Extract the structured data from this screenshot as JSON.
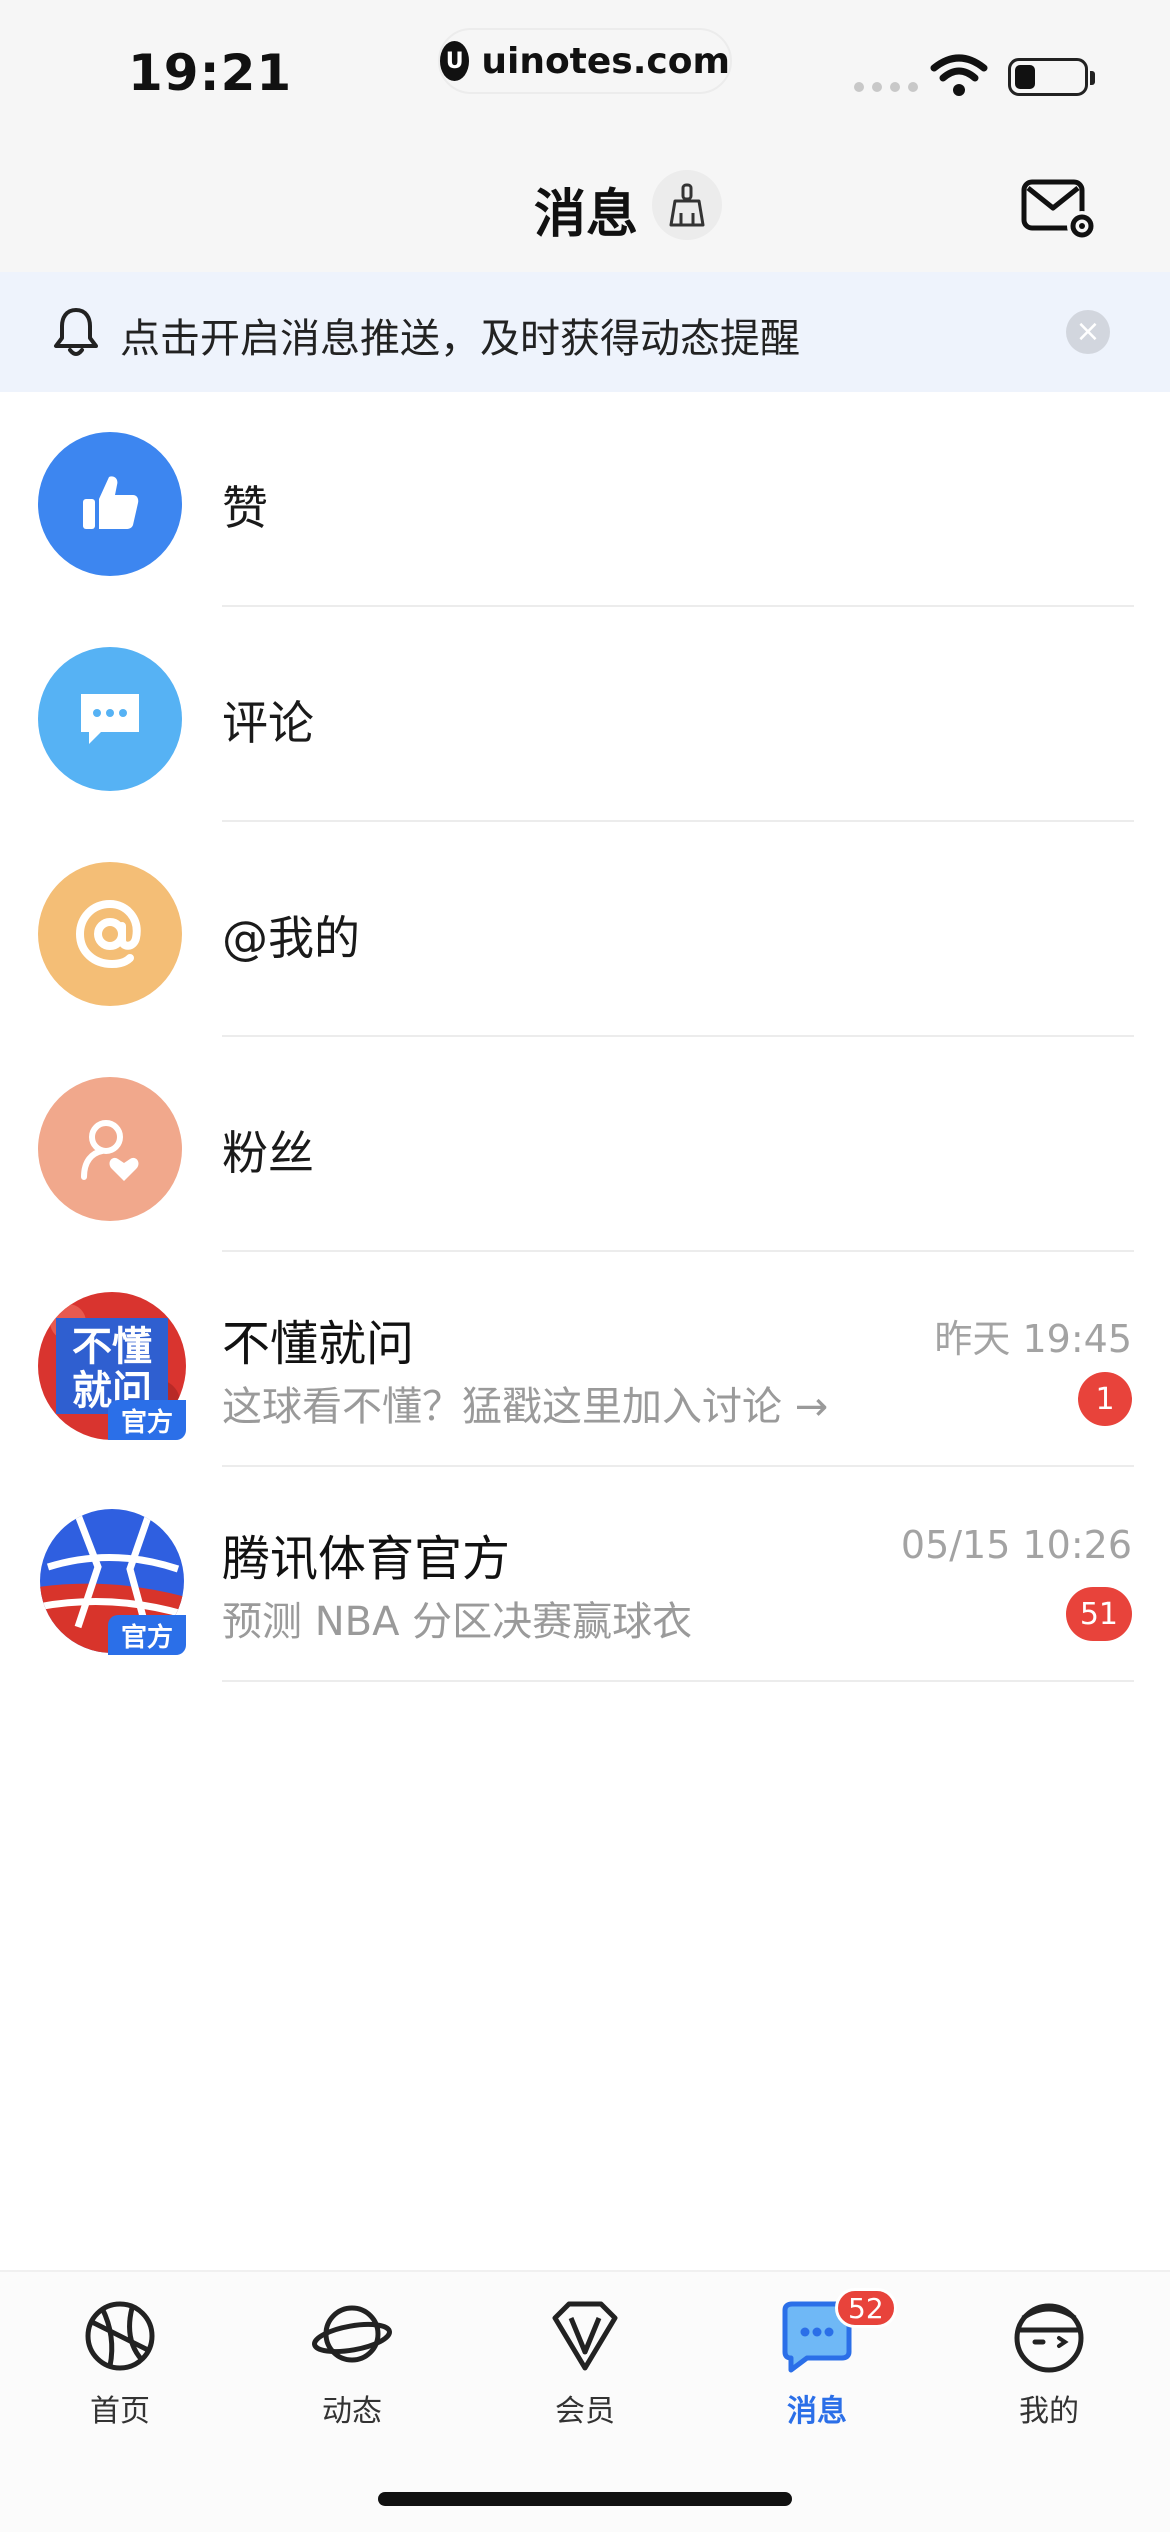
{
  "status_bar": {
    "time": "19:21",
    "url": "uinotes.com"
  },
  "header": {
    "title": "消息"
  },
  "banner": {
    "text": "点击开启消息推送，及时获得动态提醒"
  },
  "categories": [
    {
      "label": "赞",
      "icon": "thumbs-up-icon",
      "color": "#3d86f0"
    },
    {
      "label": "评论",
      "icon": "chat-bubble-icon",
      "color": "#56b2f4"
    },
    {
      "label": "@我的",
      "icon": "at-sign-icon",
      "color": "#f4be76"
    },
    {
      "label": "粉丝",
      "icon": "fan-heart-icon",
      "color": "#f1a88c"
    }
  ],
  "messages": [
    {
      "title": "不懂就问",
      "time": "昨天 19:45",
      "preview": "这球看不懂？猛戳这里加入讨论 →",
      "badge": "1",
      "avatar_text": "不懂就问",
      "tag": "官方"
    },
    {
      "title": "腾讯体育官方",
      "time": "05/15 10:26",
      "preview": "预测 NBA 分区决赛赢球衣",
      "badge": "51",
      "tag": "官方"
    }
  ],
  "tabs": [
    {
      "label": "首页",
      "icon": "basketball-icon",
      "active": false
    },
    {
      "label": "动态",
      "icon": "planet-icon",
      "active": false
    },
    {
      "label": "会员",
      "icon": "diamond-icon",
      "active": false
    },
    {
      "label": "消息",
      "icon": "message-bubble-icon",
      "active": true,
      "badge": "52"
    },
    {
      "label": "我的",
      "icon": "profile-face-icon",
      "active": false
    }
  ],
  "colors": {
    "accent": "#2b6fe8",
    "badge": "#e8433b",
    "banner_bg": "#eef3fc"
  }
}
